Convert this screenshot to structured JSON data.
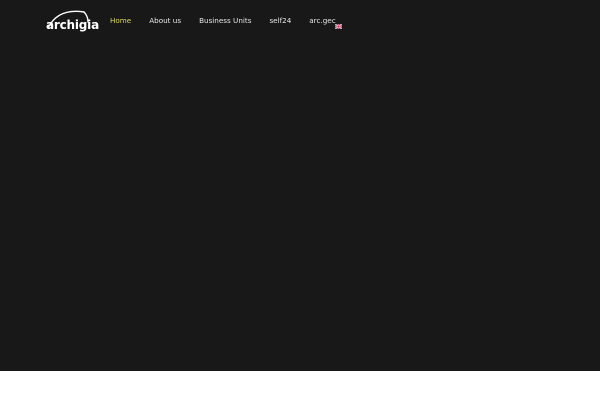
{
  "header": {
    "logo": {
      "text": "archigia",
      "icon": "arc-logo-icon"
    },
    "nav": {
      "items": [
        {
          "label": "Home",
          "active": true
        },
        {
          "label": "About us",
          "active": false
        },
        {
          "label": "Business Units",
          "active": false
        },
        {
          "label": "self24",
          "active": false
        },
        {
          "label": "arc.gec",
          "active": false
        }
      ],
      "language_icon": "uk-flag-icon"
    }
  },
  "colors": {
    "hero_background": "#181818",
    "nav_text": "#e6e6e6",
    "nav_active": "#d8d866",
    "page_background": "#ffffff"
  }
}
